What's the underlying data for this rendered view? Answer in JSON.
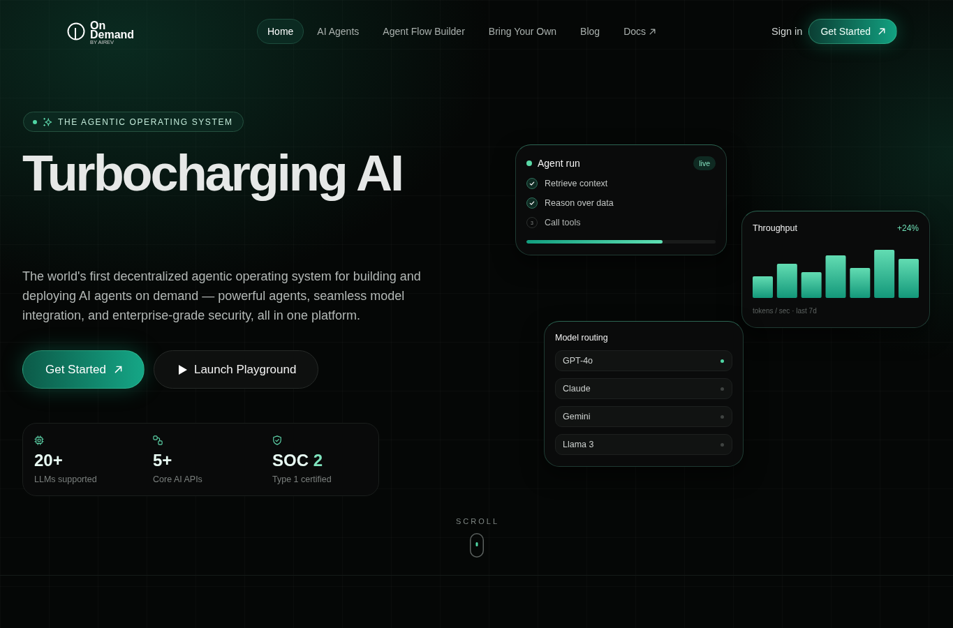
{
  "nav": {
    "brand": {
      "name": "On Demand",
      "tagline": "BY AIREV"
    },
    "links": [
      {
        "label": "Home",
        "selected": true,
        "external": false
      },
      {
        "label": "AI Agents",
        "selected": false,
        "external": false
      },
      {
        "label": "Agent Flow Builder",
        "selected": false,
        "external": false
      },
      {
        "label": "Bring Your Own",
        "selected": false,
        "external": false
      },
      {
        "label": "Blog",
        "selected": false,
        "external": false
      },
      {
        "label": "Docs",
        "selected": false,
        "external": true
      }
    ],
    "sign_in": "Sign in",
    "cta": "Get Started"
  },
  "hero": {
    "eyebrow": "THE AGENTIC OPERATING SYSTEM",
    "title": "Turbocharging AI",
    "description": "The world's first decentralized agentic operating system for building and deploying AI agents on demand — powerful agents, seamless model integration, and enterprise-grade security, all in one platform.",
    "buttons": [
      {
        "label": "Get Started",
        "kind": "primary"
      },
      {
        "label": "Launch Playground",
        "kind": "secondary"
      }
    ],
    "stats": [
      {
        "value": "20+",
        "label": "LLMs supported"
      },
      {
        "value": "5+",
        "label": "Core AI APIs"
      },
      {
        "value": "SOC ",
        "accent": "2",
        "label": "Type 1 certified"
      }
    ]
  },
  "agent_run": {
    "title": "Agent run",
    "status": "live",
    "steps": [
      {
        "label": "Retrieve context",
        "done": true
      },
      {
        "label": "Reason over data",
        "done": true
      },
      {
        "label": "Call tools",
        "done": false,
        "number": "3"
      }
    ],
    "progress": {
      "level": 0.72
    }
  },
  "throughput": {
    "title": "Throughput",
    "change": "+24%",
    "caption": "tokens / sec · last 7d"
  },
  "model_routing": {
    "title": "Model routing",
    "models": [
      {
        "name": "GPT-4o",
        "selected": true
      },
      {
        "name": "Claude",
        "selected": false
      },
      {
        "name": "Gemini",
        "selected": false
      },
      {
        "name": "Llama 3",
        "selected": false
      }
    ]
  },
  "scroll_hint": "SCROLL"
}
